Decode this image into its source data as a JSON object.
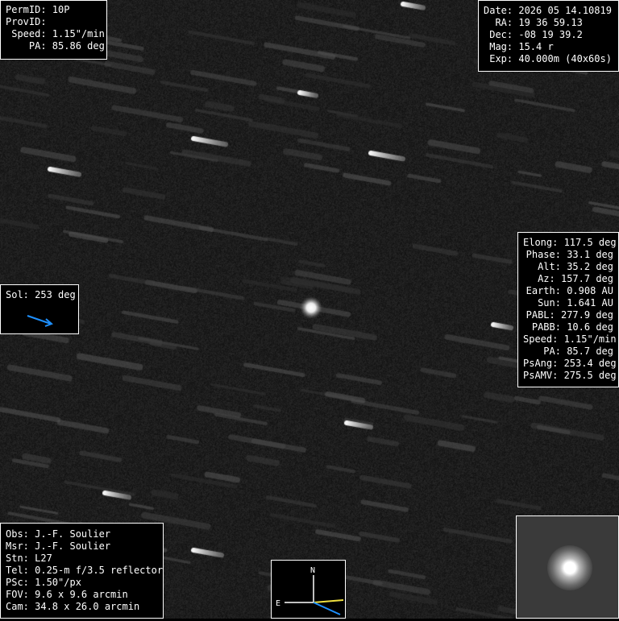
{
  "object": {
    "permid": "PermID: 10P",
    "provid": "ProvID:",
    "speed": " Speed: 1.15\"/min",
    "pa": "    PA: 85.86 deg"
  },
  "observation": {
    "date": "Date: 2026 05 14.10819",
    "ra": "  RA: 19 36 59.13",
    "dec": " Dec: -08 19 39.2",
    "mag": " Mag: 15.4 r",
    "exp": " Exp: 40.000m (40x60s)"
  },
  "sol": {
    "label": "Sol: 253 deg",
    "arrow_color": "#1e90ff"
  },
  "ephemeris": [
    "Elong: 117.5 deg",
    "Phase: 33.1 deg",
    "Alt: 35.2 deg",
    "Az: 157.7 deg",
    "Earth: 0.908 AU",
    "Sun: 1.641 AU",
    "PABL: 277.9 deg",
    "PABB: 10.6 deg",
    "Speed: 1.15\"/min",
    "PA: 85.7 deg",
    "PsAng: 253.4 deg",
    "PsAMV: 275.5 deg"
  ],
  "credits": {
    "obs": "Obs: J.-F. Soulier",
    "msr": "Msr: J.-F. Soulier",
    "stn": "Stn: L27",
    "tel": "Tel: 0.25-m f/3.5 reflector",
    "psc": "PSc: 1.50\"/px",
    "fov": "FOV: 9.6 x 9.6 arcmin",
    "cam": "Cam: 34.8 x 26.0 arcmin"
  },
  "compass": {
    "north": "N",
    "east": "E",
    "motion_color": "#f0e040",
    "sun_color": "#1e90ff"
  },
  "thumbnail": {
    "icon": "comet-closeup-icon"
  },
  "colors": {
    "panel_bg": "#000000",
    "panel_border": "#ffffff",
    "text": "#ffffff"
  }
}
